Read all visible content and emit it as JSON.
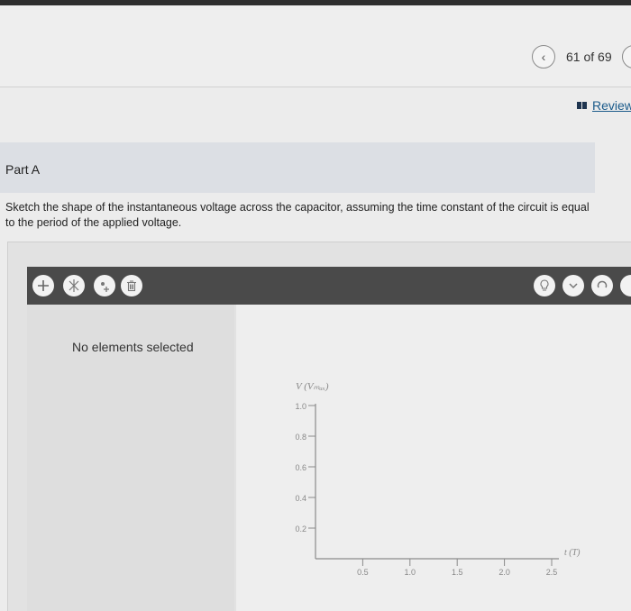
{
  "header": {
    "page_counter": "61 of 69",
    "review_label": "Review"
  },
  "part": {
    "label": "Part A"
  },
  "question": {
    "text": "Sketch the shape of the instantaneous voltage across the capacitor, assuming the time constant of the circuit is equal to the period of the applied voltage."
  },
  "toolbar": {
    "left_tools": [
      "add-icon",
      "clear-icon",
      "add-point-icon",
      "trash-icon"
    ],
    "right_tools": [
      "hint-icon",
      "check-icon",
      "reset-icon"
    ]
  },
  "panel": {
    "empty_message": "No elements selected"
  },
  "chart_data": {
    "type": "line",
    "ylabel": "V (Vₘₐₓ)",
    "xlabel": "t (T)",
    "y_ticks": [
      "1.0",
      "0.8",
      "0.6",
      "0.4",
      "0.2"
    ],
    "y_tick_values": [
      1.0,
      0.8,
      0.6,
      0.4,
      0.2
    ],
    "x_ticks": [
      "0.5",
      "1.0",
      "1.5",
      "2.0",
      "2.5"
    ],
    "x_tick_values": [
      0.5,
      1.0,
      1.5,
      2.0,
      2.5
    ],
    "xlim": [
      0,
      2.5
    ],
    "ylim": [
      0,
      1.0
    ],
    "series": [],
    "grid": false
  }
}
